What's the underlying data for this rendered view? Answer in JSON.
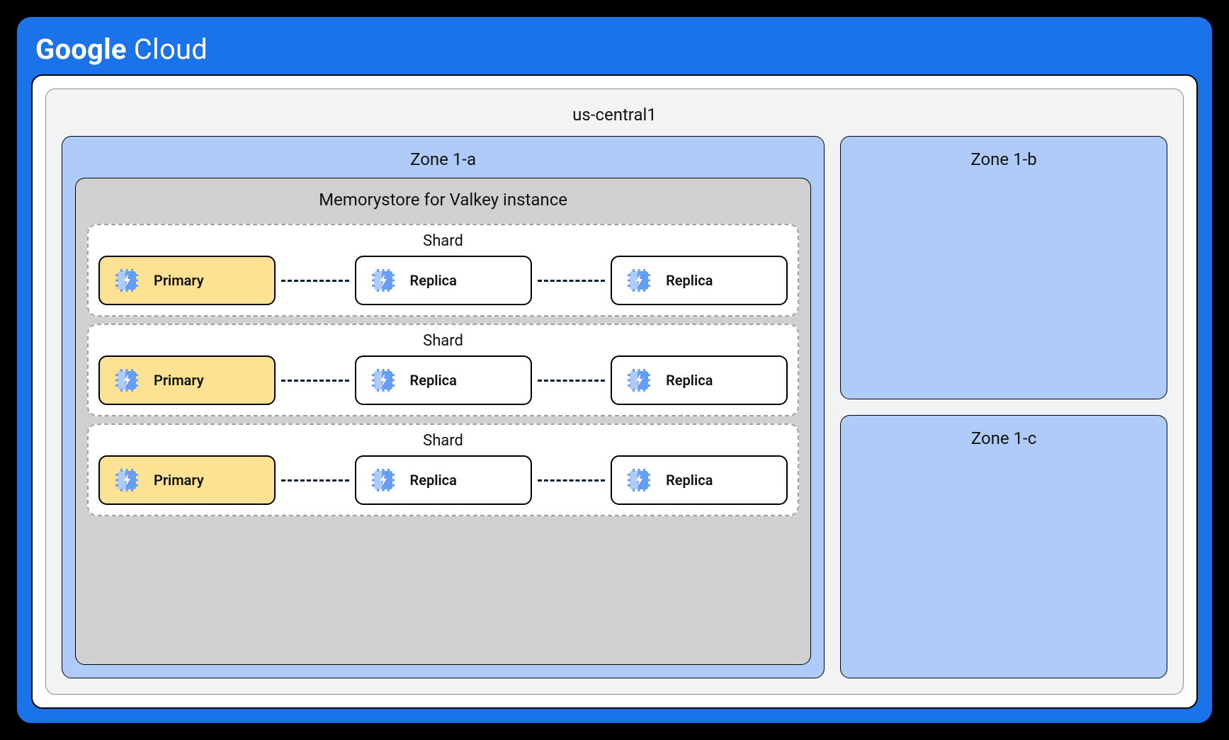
{
  "logo": {
    "bold": "Google",
    "light": "Cloud"
  },
  "region": "us-central1",
  "zones": {
    "a": {
      "title": "Zone 1-a",
      "instance_title": "Memorystore for Valkey instance",
      "shards": [
        {
          "title": "Shard",
          "nodes": [
            {
              "type": "primary",
              "label": "Primary"
            },
            {
              "type": "replica",
              "label": "Replica"
            },
            {
              "type": "replica",
              "label": "Replica"
            }
          ]
        },
        {
          "title": "Shard",
          "nodes": [
            {
              "type": "primary",
              "label": "Primary"
            },
            {
              "type": "replica",
              "label": "Replica"
            },
            {
              "type": "replica",
              "label": "Replica"
            }
          ]
        },
        {
          "title": "Shard",
          "nodes": [
            {
              "type": "primary",
              "label": "Primary"
            },
            {
              "type": "replica",
              "label": "Replica"
            },
            {
              "type": "replica",
              "label": "Replica"
            }
          ]
        }
      ]
    },
    "b": {
      "title": "Zone 1-b"
    },
    "c": {
      "title": "Zone 1-c"
    }
  },
  "colors": {
    "brand_blue": "#1a73e8",
    "zone_fill": "#aecbfa",
    "primary_fill": "#fde293",
    "instance_fill": "#d0d0d0"
  }
}
